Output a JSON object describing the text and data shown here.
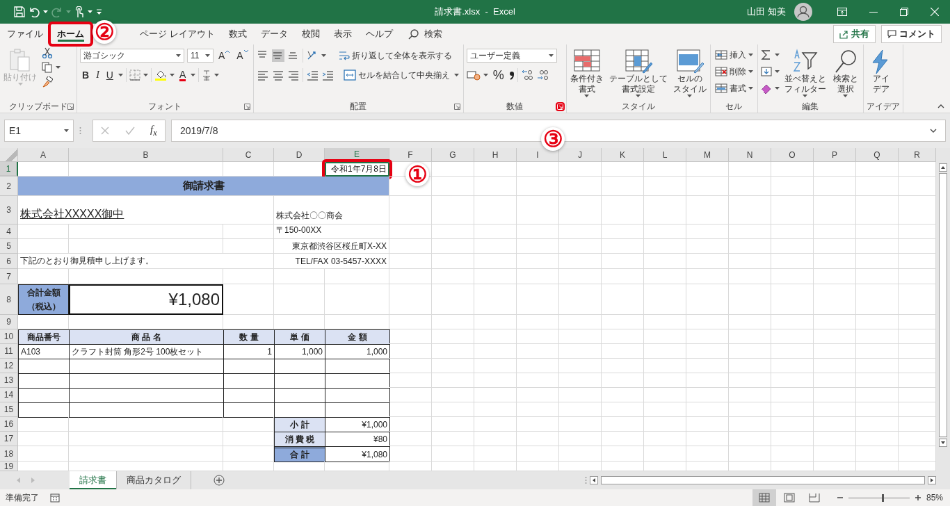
{
  "title_bar": {
    "title": "請求書.xlsx  -  Excel",
    "user": "山田 知美"
  },
  "menu_tabs": [
    {
      "label": "ファイル",
      "selected": false,
      "highlighted": false
    },
    {
      "label": "ホーム",
      "selected": true,
      "highlighted": true
    },
    {
      "label": "ページ レイアウト",
      "selected": false,
      "highlighted": false
    },
    {
      "label": "数式",
      "selected": false,
      "highlighted": false
    },
    {
      "label": "データ",
      "selected": false,
      "highlighted": false
    },
    {
      "label": "校閲",
      "selected": false,
      "highlighted": false
    },
    {
      "label": "表示",
      "selected": false,
      "highlighted": false
    },
    {
      "label": "ヘルプ",
      "selected": false,
      "highlighted": false
    }
  ],
  "search_label": "検索",
  "share_button": "共有",
  "comment_button": "コメント",
  "ribbon": {
    "groups": [
      {
        "kind": "clipboard",
        "label": "クリップボード",
        "paste": {
          "label": "貼り付け",
          "disabled": true
        },
        "launcher": {
          "highlighted": false
        }
      },
      {
        "kind": "font",
        "label": "フォント",
        "font_name": "游ゴシック",
        "font_size": "11",
        "size_buttons": [
          "A",
          "A"
        ],
        "style_buttons": [
          "B",
          "I",
          "U"
        ],
        "font_color_button": "A",
        "launcher": {
          "highlighted": false
        }
      },
      {
        "kind": "alignment",
        "label": "配置",
        "vertical_align": [
          {
            "selected": false
          },
          {
            "selected": true
          },
          {
            "selected": false
          }
        ],
        "wrap_button": "折り返して全体を表示する",
        "merge_button": "セルを結合して中央揃え",
        "launcher": {
          "highlighted": false
        }
      },
      {
        "kind": "number",
        "label": "数値",
        "format": "ユーザー定義",
        "percent_button": "%",
        "launcher": {
          "highlighted": true
        }
      },
      {
        "kind": "large_buttons",
        "label": "スタイル",
        "buttons": [
          {
            "kind": "conditional",
            "lines": [
              "条件付き",
              "書式"
            ]
          },
          {
            "kind": "table",
            "lines": [
              "テーブルとして",
              "書式設定"
            ]
          },
          {
            "kind": "cellstyle",
            "lines": [
              "セルの",
              "スタイル"
            ]
          }
        ]
      },
      {
        "kind": "small_buttons",
        "label": "セル",
        "buttons": [
          {
            "kind": "insert",
            "label": "挿入"
          },
          {
            "kind": "delete",
            "label": "削除"
          },
          {
            "kind": "format",
            "label": "書式"
          }
        ]
      },
      {
        "kind": "editing",
        "label": "編集",
        "buttons": [
          {
            "kind": "sort",
            "lines": [
              "並べ替えと",
              "フィルター"
            ]
          },
          {
            "kind": "find",
            "lines": [
              "検索と",
              "選択"
            ]
          }
        ]
      },
      {
        "kind": "large_buttons",
        "label": "アイデア",
        "buttons": [
          {
            "kind": "ideas",
            "lines": [
              "アイ",
              "デア"
            ]
          }
        ]
      }
    ]
  },
  "formula_bar": {
    "name_box": "E1",
    "function_label": "f$_{x}$",
    "formula": "2019/7/8"
  },
  "sheet": {
    "columns": [
      {
        "label": "A",
        "selected": false
      },
      {
        "label": "B",
        "selected": false
      },
      {
        "label": "C",
        "selected": false
      },
      {
        "label": "D",
        "selected": false
      },
      {
        "label": "E",
        "selected": true
      },
      {
        "label": "F",
        "selected": false
      },
      {
        "label": "G",
        "selected": false
      },
      {
        "label": "H",
        "selected": false
      },
      {
        "label": "I",
        "selected": false
      },
      {
        "label": "J",
        "selected": false
      },
      {
        "label": "K",
        "selected": false
      },
      {
        "label": "L",
        "selected": false
      },
      {
        "label": "M",
        "selected": false
      },
      {
        "label": "N",
        "selected": false
      },
      {
        "label": "O",
        "selected": false
      },
      {
        "label": "P",
        "selected": false
      },
      {
        "label": "Q",
        "selected": false
      },
      {
        "label": "R",
        "selected": false
      }
    ],
    "rows": [
      {
        "number": "1",
        "selected": true,
        "cells": [
          {
            "kind": "date",
            "text": "令和1年7月8日",
            "selected": true,
            "highlighted": true
          }
        ]
      },
      {
        "number": "2",
        "selected": false,
        "cells": [
          {
            "kind": "title",
            "text": "御請求書"
          }
        ]
      },
      {
        "number": "3",
        "selected": false,
        "cells": [
          {
            "kind": "addressee",
            "text": "株式会社XXXXX御中"
          },
          {
            "kind": "sender",
            "text": "株式会社〇〇商会"
          }
        ]
      },
      {
        "number": "4",
        "selected": false,
        "cells": [
          {
            "kind": "sender",
            "text": "〒150-00XX"
          }
        ]
      },
      {
        "number": "5",
        "selected": false,
        "cells": [
          {
            "kind": "sender-right",
            "text": "東京都渋谷区桜丘町X-XX"
          }
        ]
      },
      {
        "number": "6",
        "selected": false,
        "cells": [
          {
            "kind": "note",
            "text": "下記のとおり御見積申し上げます。"
          },
          {
            "kind": "sender-right",
            "text": "TEL/FAX 03-5457-XXXX"
          }
        ]
      },
      {
        "number": "7",
        "selected": false,
        "cells": []
      },
      {
        "number": "8",
        "selected": false,
        "cells": [
          {
            "kind": "amount-label",
            "lines": [
              "合計金額",
              "（税込）"
            ]
          },
          {
            "kind": "amount",
            "text": "¥1,080"
          }
        ]
      },
      {
        "number": "9",
        "selected": false,
        "cells": []
      },
      {
        "number": "10",
        "selected": false,
        "cells": [
          {
            "kind": "header",
            "text": "商品番号"
          },
          {
            "kind": "header",
            "text": "商 品 名"
          },
          {
            "kind": "header",
            "text": "数 量"
          },
          {
            "kind": "header",
            "text": "単 価"
          },
          {
            "kind": "header",
            "text": "金 額"
          }
        ]
      },
      {
        "number": "11",
        "selected": false,
        "cells": [
          {
            "kind": "text",
            "text": "A103"
          },
          {
            "kind": "text",
            "text": "クラフト封筒 角形2号 100枚セット"
          },
          {
            "kind": "number",
            "text": "1"
          },
          {
            "kind": "number",
            "text": "1,000"
          },
          {
            "kind": "number",
            "text": "1,000"
          }
        ]
      },
      {
        "number": "12",
        "selected": false,
        "cells": []
      },
      {
        "number": "13",
        "selected": false,
        "cells": []
      },
      {
        "number": "14",
        "selected": false,
        "cells": []
      },
      {
        "number": "15",
        "selected": false,
        "cells": []
      },
      {
        "number": "16",
        "selected": false,
        "cells": [
          {
            "kind": "sum-label",
            "text": "小 計"
          },
          {
            "kind": "sum-value",
            "text": "¥1,000"
          }
        ]
      },
      {
        "number": "17",
        "selected": false,
        "cells": [
          {
            "kind": "sum-label",
            "text": "消 費 税"
          },
          {
            "kind": "sum-value",
            "text": "¥80"
          }
        ]
      },
      {
        "number": "18",
        "selected": false,
        "cells": [
          {
            "kind": "total-label",
            "text": "合 計"
          },
          {
            "kind": "sum-value",
            "text": "¥1,080"
          }
        ]
      },
      {
        "number": "19",
        "selected": false,
        "cells": []
      }
    ]
  },
  "sheet_tabs": [
    {
      "label": "請求書",
      "selected": true
    },
    {
      "label": "商品カタログ",
      "selected": false
    }
  ],
  "status_bar": {
    "status": "準備完了",
    "views": [
      {
        "selected": true
      },
      {
        "selected": false
      },
      {
        "selected": false
      }
    ],
    "zoom": {
      "level": 0.56,
      "reading": "85%"
    }
  },
  "annotations": [
    {
      "text": "②"
    },
    {
      "text": "③"
    },
    {
      "text": "①"
    }
  ]
}
